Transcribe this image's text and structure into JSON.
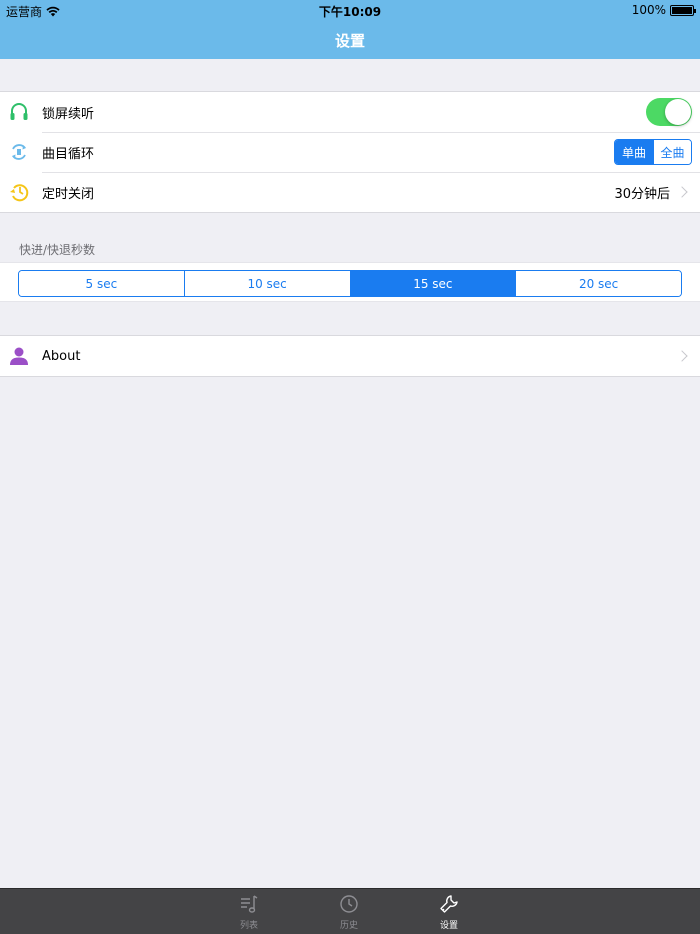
{
  "status_bar": {
    "carrier": "运营商",
    "time": "下午10:09",
    "battery": "100%"
  },
  "nav": {
    "title": "设置"
  },
  "settings": {
    "lock_screen": {
      "label": "锁屏续听",
      "enabled": true
    },
    "loop": {
      "label": "曲目循环",
      "options": [
        "单曲",
        "全曲"
      ],
      "selected": "单曲"
    },
    "timer": {
      "label": "定时关闭",
      "value": "30分钟后"
    }
  },
  "seek_section": {
    "header": "快进/快退秒数",
    "options": [
      "5 sec",
      "10 sec",
      "15 sec",
      "20 sec"
    ],
    "selected": "15 sec"
  },
  "about": {
    "label": "About"
  },
  "tabbar": {
    "tabs": [
      {
        "label": "列表",
        "icon": "music-list-icon"
      },
      {
        "label": "历史",
        "icon": "clock-icon"
      },
      {
        "label": "设置",
        "icon": "wrench-icon"
      }
    ],
    "active": "设置"
  },
  "colors": {
    "nav_bg": "#6bbaea",
    "accent": "#1a7cf0",
    "toggle_on": "#4cd964",
    "tabbar_bg": "#444446"
  }
}
